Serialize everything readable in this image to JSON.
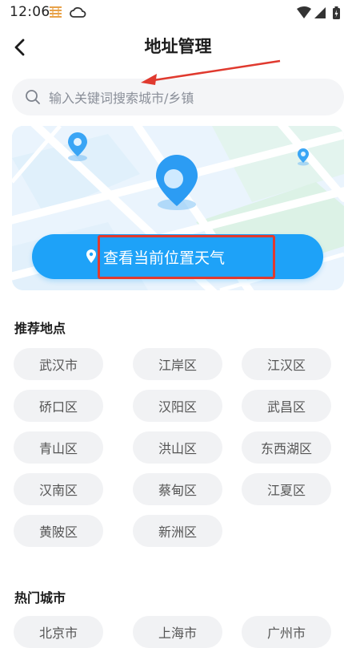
{
  "status_bar": {
    "time": "12:06"
  },
  "header": {
    "title": "地址管理"
  },
  "search": {
    "placeholder": "输入关键词搜索城市/乡镇"
  },
  "locate": {
    "label": "查看当前位置天气"
  },
  "recommended": {
    "title": "推荐地点",
    "items": [
      "武汉市",
      "江岸区",
      "江汉区",
      "硚口区",
      "汉阳区",
      "武昌区",
      "青山区",
      "洪山区",
      "东西湖区",
      "汉南区",
      "蔡甸区",
      "江夏区",
      "黄陂区",
      "新洲区"
    ]
  },
  "hot_cities": {
    "title": "热门城市",
    "items": [
      "北京市",
      "上海市",
      "广州市"
    ]
  },
  "colors": {
    "accent": "#1ea2f8",
    "highlight": "#e03a2f",
    "chip_bg": "#f1f2f4"
  }
}
